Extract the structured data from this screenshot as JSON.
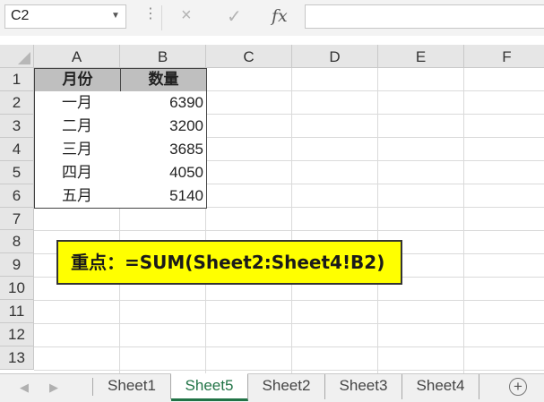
{
  "formula_bar": {
    "name_box": "C2",
    "cancel_icon": "×",
    "enter_icon": "✓",
    "fx_label": "fx",
    "formula": ""
  },
  "columns": [
    "A",
    "B",
    "C",
    "D",
    "E",
    "F"
  ],
  "rows": [
    "1",
    "2",
    "3",
    "4",
    "5",
    "6",
    "7",
    "8",
    "9",
    "10",
    "11",
    "12",
    "13"
  ],
  "table": {
    "header_month": "月份",
    "header_qty": "数量",
    "data": [
      {
        "month": "一月",
        "qty": "6390"
      },
      {
        "month": "二月",
        "qty": "3200"
      },
      {
        "month": "三月",
        "qty": "3685"
      },
      {
        "month": "四月",
        "qty": "4050"
      },
      {
        "month": "五月",
        "qty": "5140"
      }
    ]
  },
  "note": "重点：=SUM(Sheet2:Sheet4!B2)",
  "sheet_tabs": [
    "Sheet1",
    "Sheet5",
    "Sheet2",
    "Sheet3",
    "Sheet4"
  ],
  "active_tab": "Sheet5",
  "colors": {
    "accent": "#217346",
    "note_bg": "#ffff00",
    "header_bg": "#bfbfbf"
  }
}
